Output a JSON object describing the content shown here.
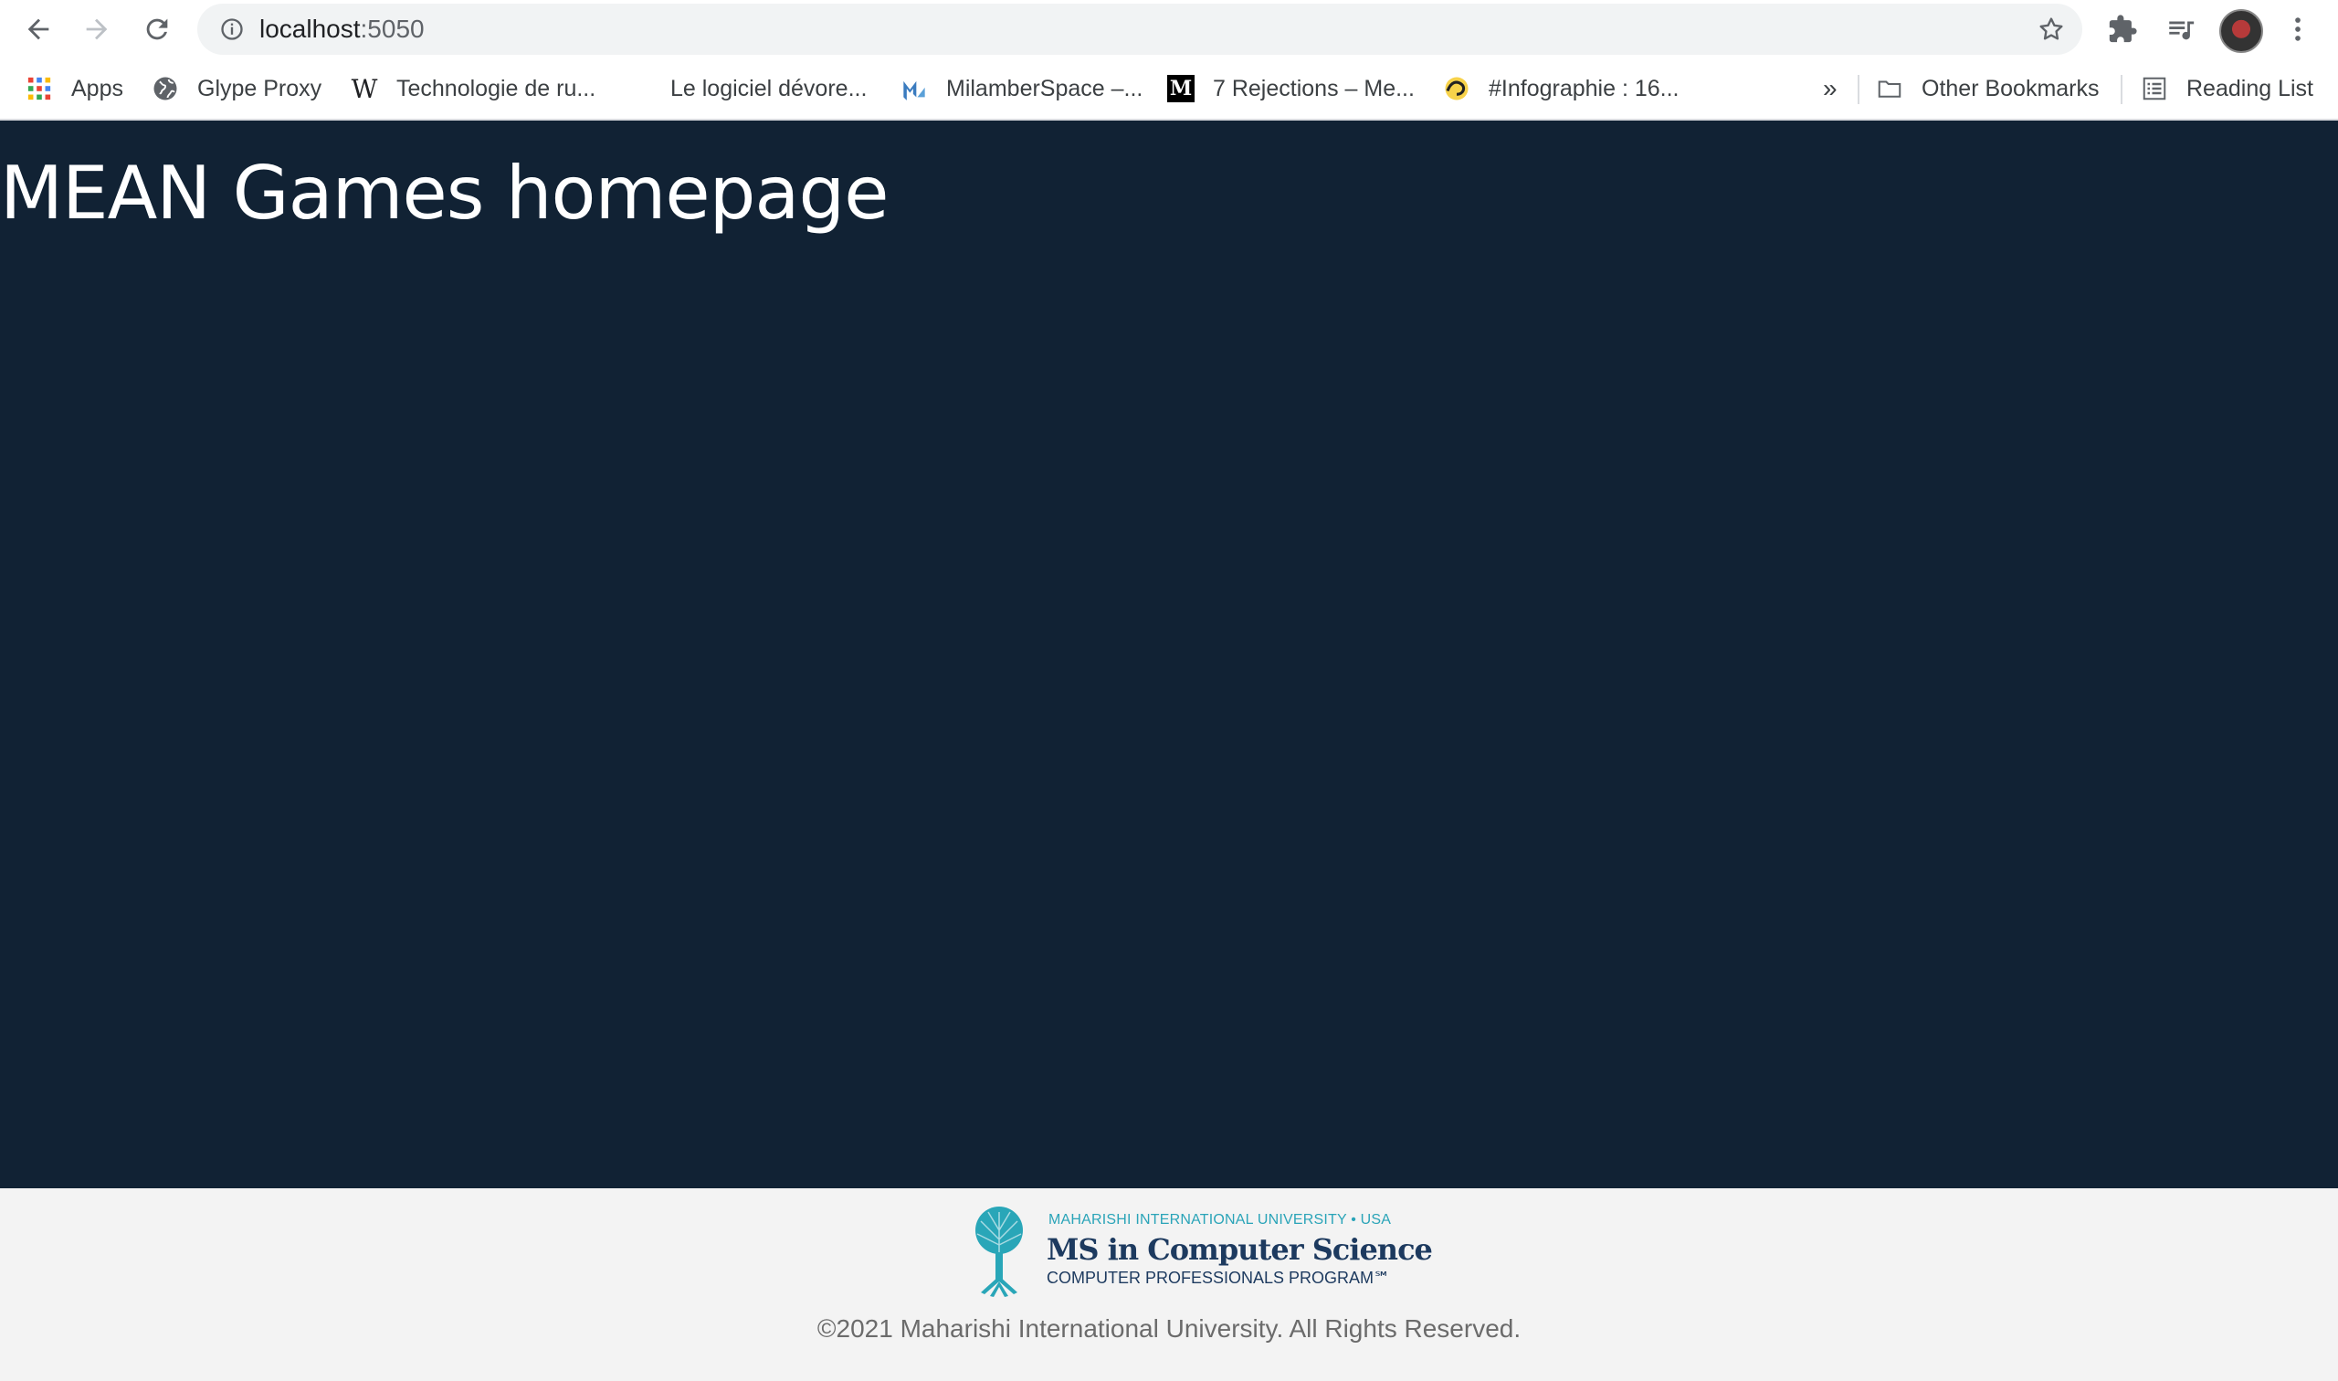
{
  "browser": {
    "url_host": "localhost",
    "url_port": ":5050",
    "bookmarks": [
      {
        "label": "Apps",
        "icon": "apps-grid-icon"
      },
      {
        "label": "Glype Proxy",
        "icon": "globe-icon"
      },
      {
        "label": "Technologie de ru...",
        "icon": "wikipedia-icon"
      },
      {
        "label": "Le logiciel dévore...",
        "icon": "blank"
      },
      {
        "label": "MilamberSpace –...",
        "icon": "milamber-icon"
      },
      {
        "label": "7 Rejections – Me...",
        "icon": "medium-icon"
      },
      {
        "label": "#Infographie : 16...",
        "icon": "site-icon"
      }
    ],
    "overflow_label": "»",
    "other_bookmarks": "Other Bookmarks",
    "reading_list": "Reading List"
  },
  "page": {
    "title": "MEAN Games homepage",
    "background_color": "#112234"
  },
  "footer": {
    "logo": {
      "line1": "MAHARISHI INTERNATIONAL UNIVERSITY • USA",
      "line2": "MS in Computer Science",
      "line3": "COMPUTER PROFESSIONALS PROGRAM℠"
    },
    "copyright": "©2021 Maharishi International University. All Rights Reserved."
  }
}
